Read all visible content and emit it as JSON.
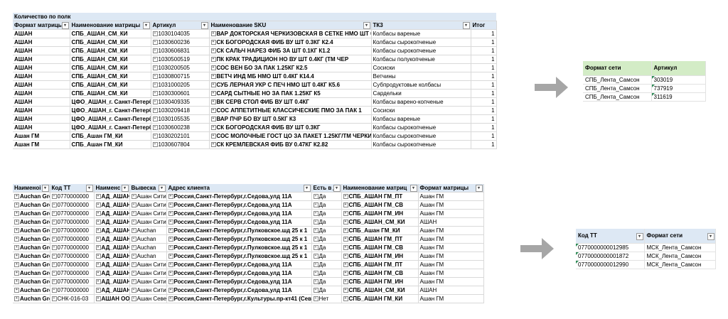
{
  "top_table": {
    "caption": "Количество по полк",
    "headers": [
      "Формат матрицы",
      "Наименование матрицы",
      "Артикул",
      "Наименование SKU",
      "ТК3",
      "Итог"
    ],
    "rows": [
      [
        "АШАН",
        "СПБ_АШАН_СМ_КИ",
        "1030104035",
        "ВАР ДОКТОРСКАЯ ЧЕРКИЗОВСКАЯ В СЕТКЕ НМО ШТ 0.5КГ",
        "Колбасы вареные",
        "1"
      ],
      [
        "АШАН",
        "СПБ_АШАН_СМ_КИ",
        "1030600236",
        "СК БОГОРОДСКАЯ ФИБ ВУ ШТ 0.3КГ К2.4",
        "Колбасы сырокопченые",
        "1"
      ],
      [
        "АШАН",
        "СПБ_АШАН_СМ_КИ",
        "1030606831",
        "СК САЛЬЧ НАРЕЗ ФИБ ЗА ШТ 0.1КГ К1.2",
        "Колбасы сырокопченые",
        "1"
      ],
      [
        "АШАН",
        "СПБ_АШАН_СМ_КИ",
        "1030500519",
        "ПК КРАК ТРАДИЦИОН НО ВУ ШТ 0.4КГ (ТМ ЧЕР",
        "Колбасы полукопченые",
        "1"
      ],
      [
        "АШАН",
        "СПБ_АШАН_СМ_КИ",
        "1030200505",
        "СОС ВЕН БО ЗА ПАК 1.25КГ К2.5",
        "Сосиски",
        "1"
      ],
      [
        "АШАН",
        "СПБ_АШАН_СМ_КИ",
        "1030800715",
        "ВЕТЧ ИНД МБ НМО ШТ 0.4КГ К14.4",
        "Ветчины",
        "1"
      ],
      [
        "АШАН",
        "СПБ_АШАН_СМ_КИ",
        "1031000205",
        "СУБ ЛЕРНАЯ УКР С ПЕЧ НМО ШТ 0.4КГ К5.6",
        "Субпродуктовые колбасы",
        "1"
      ],
      [
        "АШАН",
        "СПБ_АШАН_СМ_КИ",
        "1030300601",
        "САРД СЫТНЫЕ НО ЗА ПАК 1.25КГ К5",
        "Сардельки",
        "1"
      ],
      [
        "АШАН",
        "ЦФО_АШАН_г. Санкт-Петерб",
        "1030409335",
        "ВК СЕРВ СТОЛ ФИБ ВУ ШТ 0.4КГ",
        "Колбасы варено-копченые",
        "1"
      ],
      [
        "АШАН",
        "ЦФО_АШАН_г. Санкт-Петерб",
        "1030209418",
        "СОС АППЕТИТНЫЕ КЛАССИЧЕСКИЕ ПМО ЗА ПАК 1",
        "Сосиски",
        "1"
      ],
      [
        "АШАН",
        "ЦФО_АШАН_г. Санкт-Петерб",
        "1030105535",
        "ВАР ПЧР БО ВУ ШТ 0.5КГ К3",
        "Колбасы вареные",
        "1"
      ],
      [
        "АШАН",
        "ЦФО_АШАН_г. Санкт-Петерб",
        "1030600238",
        "СК БОГОРОДСКАЯ ФИБ ВУ ШТ 0.3КГ",
        "Колбасы сырокопченые",
        "1"
      ],
      [
        "Ашан ГМ",
        "СПБ_Ашан ГМ_КИ",
        "1030202101",
        "СОС МОЛОЧНЫЕ ГОСТ ЦО ЗА ПАКЕТ 1.25КГ/ТМ ЧЕРКИЗО",
        "Колбасы сырокопченые",
        "1"
      ],
      [
        "Ашан ГМ",
        "СПБ_Ашан ГМ_КИ",
        "1030607804",
        "СК КРЕМЛЕВСКАЯ ФИБ ВУ 0.47КГ К2.82",
        "Колбасы сырокопченые",
        "1"
      ]
    ]
  },
  "right_top_table": {
    "headers": [
      "Формат сети",
      "Артикул"
    ],
    "rows": [
      [
        "СПБ_Лента_Самсон",
        "303019"
      ],
      [
        "СПБ_Лента_Самсон",
        "737919"
      ],
      [
        "СПБ_Лента_Самсон",
        "311619"
      ]
    ]
  },
  "bottom_table": {
    "headers": [
      "Наименоі",
      "Код ТТ",
      "Наименс",
      "Вывеска",
      "Адрес клиента",
      "Есть в д",
      "Наименование матриц",
      "Формат матрицы"
    ],
    "rows": [
      [
        "Auchan Gro",
        "0770000000",
        "АД_АШАН",
        "Ашан Сити",
        "Россия,Санкт-Петербург,г.Седова,улд 11А",
        "Да",
        "СПБ_АШАН ГМ_ПТ",
        "Ашан ГМ"
      ],
      [
        "Auchan Gro",
        "0770000000",
        "АД_АШАН",
        "Ашан Сити",
        "Россия,Санкт-Петербург,г.Седова,улд 11А",
        "Да",
        "СПБ_АШАН ГМ_СВ",
        "Ашан ГМ"
      ],
      [
        "Auchan Gro",
        "0770000000",
        "АД_АШАН",
        "Ашан Сити",
        "Россия,Санкт-Петербург,г.Седова,улд 11А",
        "Да",
        "СПБ_АШАН ГМ_ИН",
        "Ашан ГМ"
      ],
      [
        "Auchan Gro",
        "0770000000",
        "АД_АШАН",
        "Ашан Сити",
        "Россия,Санкт-Петербург,г.Седова,улд 11А",
        "Да",
        "СПБ_АШАН_СМ_КИ",
        "АШАН"
      ],
      [
        "Auchan Gro",
        "0770000000",
        "АД_АШАН",
        "Auchan",
        "Россия,Санкт-Петербург,г.Пулковское.шд 25 к 1",
        "Да",
        "СПБ_Ашан ГМ_КИ",
        "Ашан ГМ"
      ],
      [
        "Auchan Gro",
        "0770000000",
        "АД_АШАН",
        "Auchan",
        "Россия,Санкт-Петербург,г.Пулковское.шд 25 к 1",
        "Да",
        "СПБ_АШАН ГМ_ПТ",
        "Ашан ГМ"
      ],
      [
        "Auchan Gro",
        "0770000000",
        "АД_АШАН",
        "Auchan",
        "Россия,Санкт-Петербург,г.Пулковское.шд 25 к 1",
        "Да",
        "СПБ_АШАН ГМ_СВ",
        "Ашан ГМ"
      ],
      [
        "Auchan Gro",
        "0770000000",
        "АД_АШАН",
        "Auchan",
        "Россия,Санкт-Петербург,г.Пулковское.шд 25 к 1",
        "Да",
        "СПБ_АШАН ГМ_ИН",
        "Ашан ГМ"
      ],
      [
        "Auchan Gro",
        "0770000000",
        "АД_АШАН",
        "Ашан Сити",
        "Россия,Санкт-Петербург,г.Седова,улд 11А",
        "Да",
        "СПБ_АШАН ГМ_ПТ",
        "Ашан ГМ"
      ],
      [
        "Auchan Gro",
        "0770000000",
        "АД_АШАН",
        "Ашан Сити",
        "Россия,Санкт-Петербург,г.Седова,улд 11А",
        "Да",
        "СПБ_АШАН ГМ_СВ",
        "Ашан ГМ"
      ],
      [
        "Auchan Gro",
        "0770000000",
        "АД_АШАН",
        "Ашан Сити",
        "Россия,Санкт-Петербург,г.Седова,улд 11А",
        "Да",
        "СПБ_АШАН ГМ_ИН",
        "Ашан ГМ"
      ],
      [
        "Auchan Gro",
        "0770000000",
        "АД_АШАН",
        "Ашан Сити",
        "Россия,Санкт-Петербург,г.Седова,улд 11А",
        "Да",
        "СПБ_АШАН_СМ_КИ",
        "АШАН"
      ],
      [
        "Auchan Gro",
        "СНК-016-03",
        "АШАН ООС",
        "Ашан Севе",
        "Россия,Санкт-Петербург,г.Культуры.пр-кт41 (Севе",
        "Нет",
        "СПБ_АШАН ГМ_КИ",
        "Ашан ГМ"
      ]
    ]
  },
  "right_bottom_table": {
    "headers": [
      "Код ТТ",
      "Формат сети"
    ],
    "rows": [
      [
        "0770000000012985",
        "МСК_Лента_Самсон"
      ],
      [
        "0770000000001872",
        "МСК_Лента_Самсон"
      ],
      [
        "0770000000012990",
        "МСК_Лента_Самсон"
      ]
    ]
  },
  "colors": {
    "header_blue": "#dde8f4",
    "header_green": "#d3ecc6",
    "arrow": "#a6a6a6"
  }
}
